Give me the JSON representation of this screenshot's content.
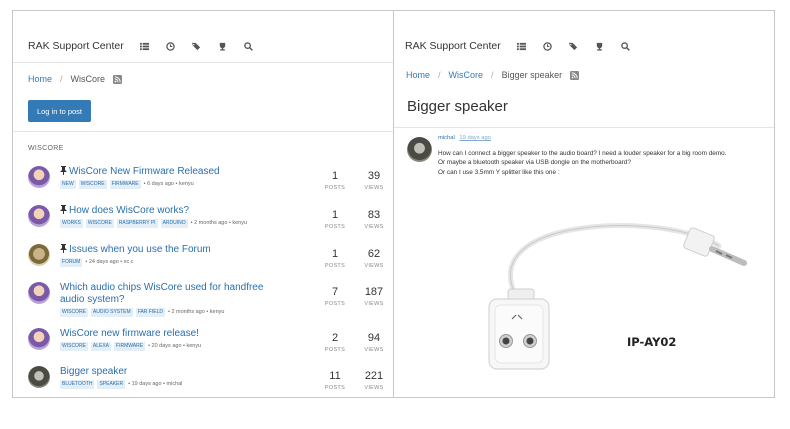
{
  "left": {
    "brand": "RAK Support Center",
    "nav_icons": [
      "list-icon",
      "clock-icon",
      "tags-icon",
      "trophy-icon",
      "search-icon"
    ],
    "breadcrumb": {
      "home": "Home",
      "current": "WisCore"
    },
    "login_button": "Log in to post",
    "category_label": "WISCORE",
    "stats_labels": {
      "posts": "POSTS",
      "views": "VIEWS"
    },
    "topics": [
      {
        "title": "WisCore New Firmware Released",
        "pinned": true,
        "tags": [
          "NEW",
          "WISCORE",
          "FIRMWARE"
        ],
        "time": "6 days ago",
        "author": "kenyu",
        "posts": "1",
        "views": "39"
      },
      {
        "title": "How does WisCore works?",
        "pinned": true,
        "tags": [
          "WORKS",
          "WISCORE",
          "RASPBERRY PI",
          "ARDUINO"
        ],
        "time": "2 months ago",
        "author": "kenyu",
        "posts": "1",
        "views": "83"
      },
      {
        "title": "Issues when you use the Forum",
        "pinned": true,
        "tags": [
          "FORUM"
        ],
        "time": "24 days ago",
        "author": "xc.c",
        "posts": "1",
        "views": "62"
      },
      {
        "title": "Which audio chips WisCore used for handfree audio system?",
        "pinned": false,
        "tags": [
          "WISCORE",
          "AUDIO SYSTEM",
          "FAR FIELD"
        ],
        "time": "2 months ago",
        "author": "kenyu",
        "posts": "7",
        "views": "187"
      },
      {
        "title": "WisCore new firmware release!",
        "pinned": false,
        "tags": [
          "WISCORE",
          "ALEXA",
          "FIRMWARE"
        ],
        "time": "20 days ago",
        "author": "kenyu",
        "posts": "2",
        "views": "94"
      },
      {
        "title": "Bigger speaker",
        "pinned": false,
        "tags": [
          "BLUETOOTH",
          "SPEAKER"
        ],
        "time": "19 days ago",
        "author": "michal",
        "posts": "11",
        "views": "221"
      }
    ]
  },
  "right": {
    "brand": "RAK Support Center",
    "breadcrumb": {
      "home": "Home",
      "category": "WisCore",
      "current": "Bigger speaker"
    },
    "post_title": "Bigger speaker",
    "post": {
      "author": "michal",
      "time": "19 days ago",
      "lines": [
        "How can I connect a bigger speaker to the audio board? I need a louder speaker for a big room demo.",
        "Or maybe a bluetooth speaker via USB dongle on the motherboard?",
        "Or can I use 3.5mm Y splitter like this one :"
      ],
      "image_caption": "IP-AY02"
    }
  },
  "colors": {
    "link": "#337ab7",
    "tag_bg": "#e3eef7",
    "tag_text": "#2a6fad"
  }
}
